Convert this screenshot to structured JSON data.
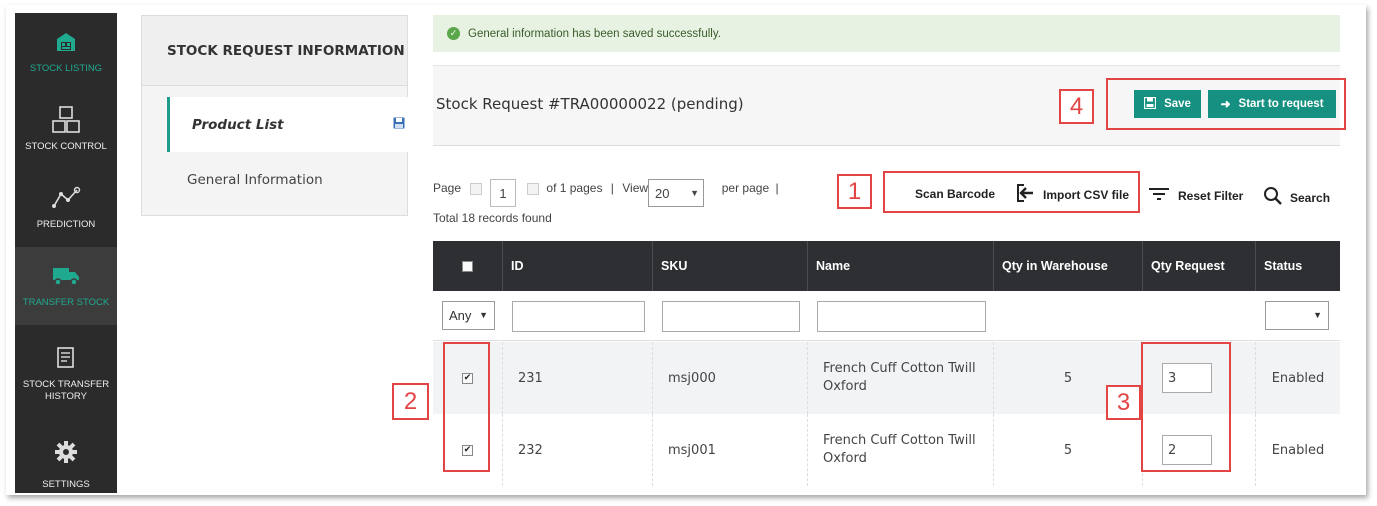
{
  "sidebar": {
    "items": [
      {
        "label": "STOCK LISTING",
        "icon": "warehouse-icon"
      },
      {
        "label": "STOCK CONTROL",
        "icon": "boxes-icon"
      },
      {
        "label": "PREDICTION",
        "icon": "chart-line-icon"
      },
      {
        "label": "TRANSFER STOCK",
        "icon": "truck-icon"
      },
      {
        "label": "STOCK TRANSFER HISTORY",
        "icon": "history-icon"
      },
      {
        "label": "SETTINGS",
        "icon": "gear-icon"
      }
    ]
  },
  "left_panel": {
    "title": "STOCK REQUEST INFORMATION",
    "items": [
      {
        "label": "Product List"
      },
      {
        "label": "General Information"
      }
    ]
  },
  "message": "General information has been saved successfully.",
  "header": {
    "title": "Stock Request #TRA00000022 (pending)",
    "save_label": "Save",
    "start_label": "Start to request"
  },
  "pager": {
    "page_label": "Page",
    "page_value": "1",
    "of_pages": "of 1 pages",
    "separator": "|",
    "view_label": "View",
    "view_value": "20",
    "per_page": "per page",
    "total": "Total 18 records found"
  },
  "toolbar": {
    "scan_barcode": "Scan Barcode",
    "import_csv": "Import CSV file",
    "reset_filter": "Reset Filter",
    "search": "Search"
  },
  "table": {
    "columns": [
      "ID",
      "SKU",
      "Name",
      "Qty in Warehouse",
      "Qty Request",
      "Status"
    ],
    "filter_any": "Any",
    "rows": [
      {
        "id": "231",
        "sku": "msj000",
        "name_line1": "French Cuff Cotton Twill",
        "name_line2": "Oxford",
        "qty_warehouse": "5",
        "qty_request": "3",
        "status": "Enabled",
        "checked": true
      },
      {
        "id": "232",
        "sku": "msj001",
        "name_line1": "French Cuff Cotton Twill",
        "name_line2": "Oxford",
        "qty_warehouse": "5",
        "qty_request": "2",
        "status": "Enabled",
        "checked": true
      }
    ]
  },
  "annotations": [
    "1",
    "2",
    "3",
    "4"
  ],
  "colors": {
    "accent": "#169080",
    "sidebar": "#2b2b2b",
    "annotation": "#e34444",
    "header": "#2d2f33"
  }
}
